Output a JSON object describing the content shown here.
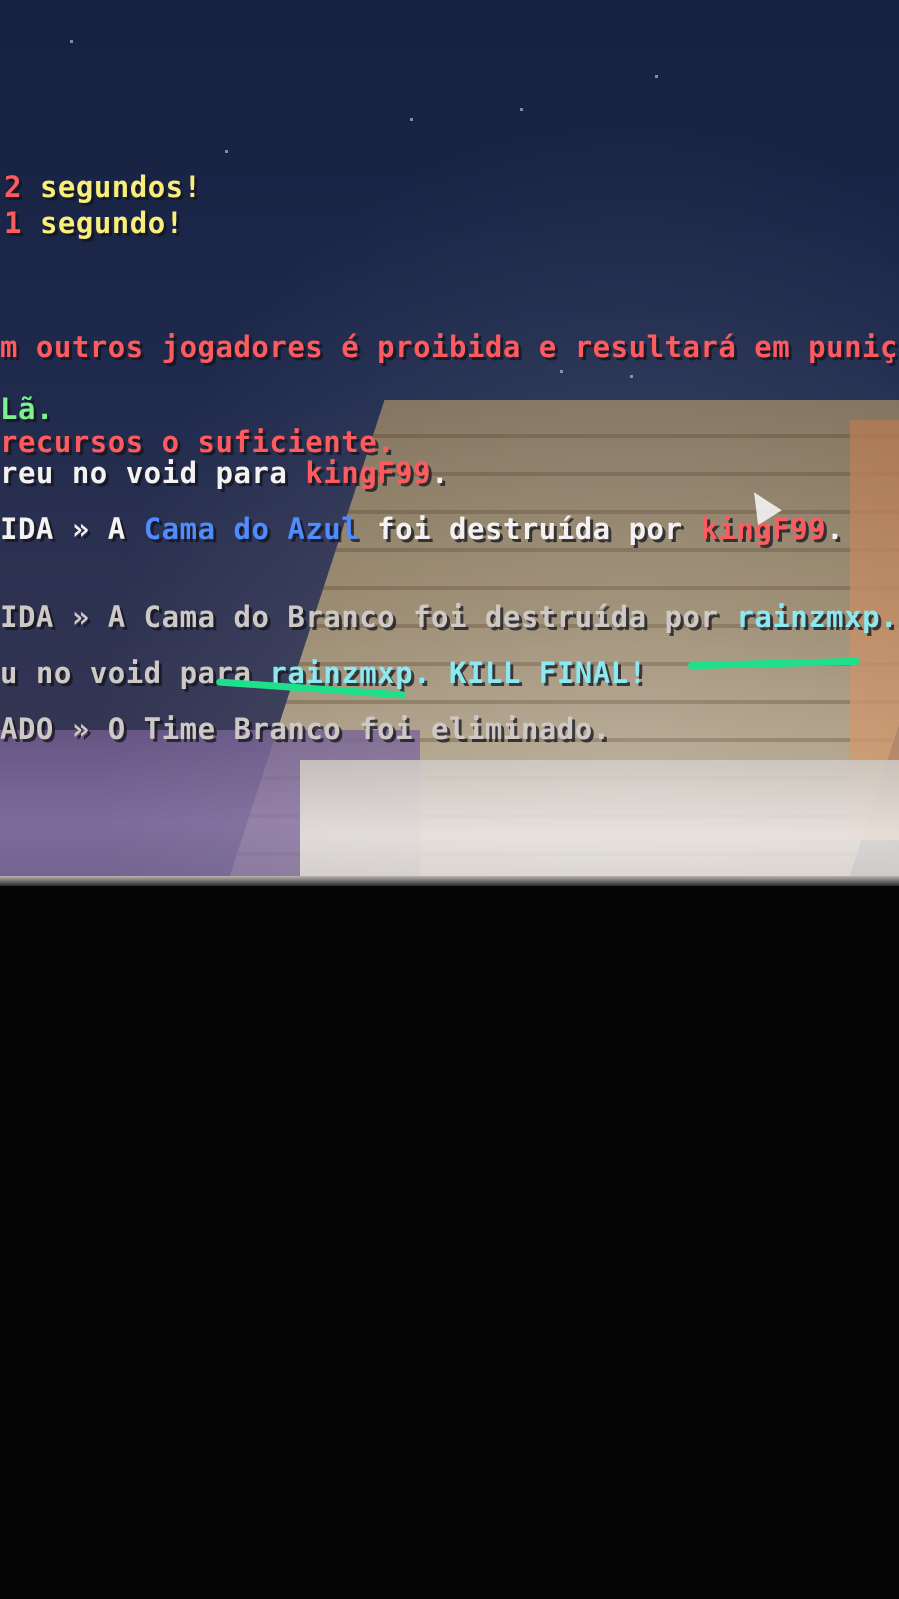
{
  "chat": {
    "countdown_2_num": "2",
    "countdown_2_text": "segundos!",
    "countdown_1_num": "1",
    "countdown_1_text": "segundo!",
    "warning": "m outros jogadores é proibida e resultará em puniçã",
    "line_la": "Lã.",
    "line_recursos": "recursos o suficiente.",
    "line_void1_prefix": "reu no void para ",
    "line_void1_player": "kingF99",
    "line_void1_suffix": ".",
    "bed_azul_prefix": "IDA » ",
    "bed_azul_a": "A ",
    "bed_azul_team": "Cama do Azul",
    "bed_azul_mid": " foi destruída por ",
    "bed_azul_player": "kingF99",
    "bed_azul_suffix": ".",
    "bed_branco_prefix": "IDA » ",
    "bed_branco_text": "A Cama do Branco foi destruída por ",
    "bed_branco_player": "rainzmxp",
    "bed_branco_suffix": ".",
    "void2_prefix": "u no void para ",
    "void2_player": "rainzmxp",
    "void2_final": ". KILL FINAL!",
    "eliminated_prefix": "ADO » ",
    "eliminated_text": "O Time Branco foi eliminado."
  },
  "colors": {
    "red": "#ff5a5e",
    "yellow": "#f9ee7a",
    "green": "#7cf28c",
    "white": "#f4f1f1",
    "blue": "#4f8cff",
    "aqua": "#8be9f2",
    "highlight": "#1fe08a"
  },
  "icons": {
    "cursor": "mouse-cursor-icon"
  }
}
